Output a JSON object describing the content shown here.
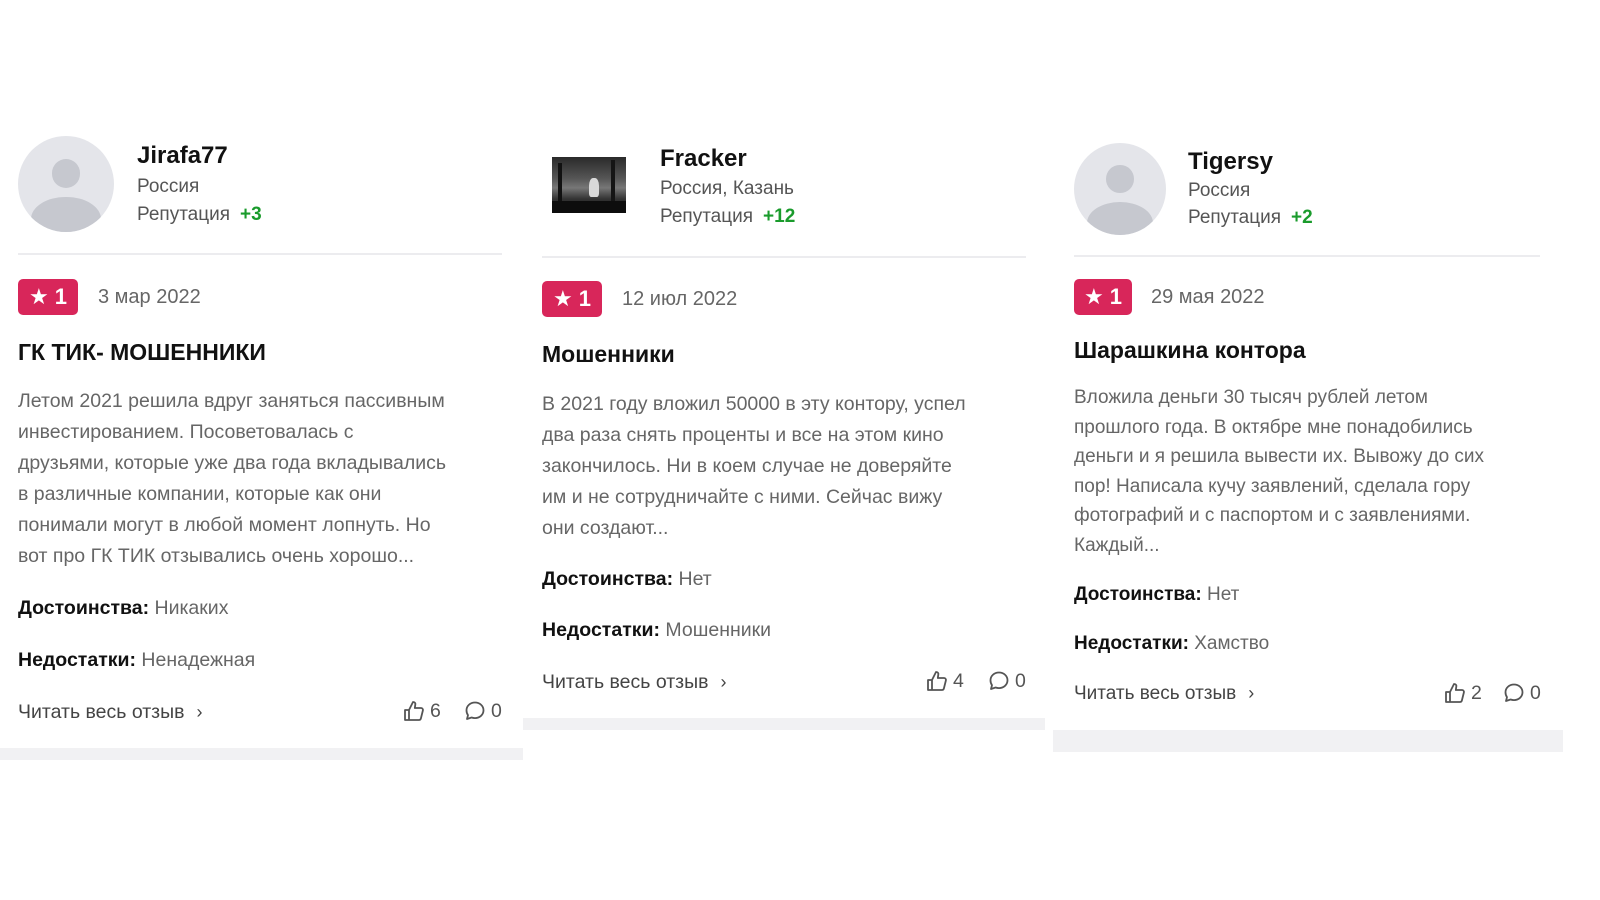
{
  "reviews": [
    {
      "user": {
        "name": "Jirafa77",
        "location": "Россия",
        "reputation_label": "Репутация",
        "reputation": "+3",
        "avatar": "default-avatar"
      },
      "rating": "1",
      "date": "3 мар 2022",
      "title": "ГК ТИК- МОШЕННИКИ",
      "text_lines": [
        "Летом 2021 решила вдруг заняться пассивным",
        "инвестированием. Посоветовалась с",
        "друзьями, которые уже два года вкладывались",
        "в различные компании, которые как они",
        "понимали могут в любой момент лопнуть. Но",
        "вот про ГК ТИК отзывались очень хорошо..."
      ],
      "pros_label": "Достоинства:",
      "pros": "Никаких",
      "cons_label": "Недостатки:",
      "cons": "Ненадежная",
      "read_more": "Читать весь отзыв",
      "likes": "6",
      "comments": "0"
    },
    {
      "user": {
        "name": "Fracker",
        "location": "Россия, Казань",
        "reputation_label": "Репутация",
        "reputation": "+12",
        "avatar": "photo-avatar"
      },
      "rating": "1",
      "date": "12 июл 2022",
      "title": "Мошенники",
      "text_lines": [
        "В 2021 году вложил 50000 в эту контору, успел",
        "два раза снять проценты и все на этом кино",
        "закончилось. Ни в коем случае не доверяйте",
        "им и не сотрудничайте с ними. Сейчас вижу",
        "они создают..."
      ],
      "pros_label": "Достоинства:",
      "pros": "Нет",
      "cons_label": "Недостатки:",
      "cons": "Мошенники",
      "read_more": "Читать весь отзыв",
      "likes": "4",
      "comments": "0"
    },
    {
      "user": {
        "name": "Tigersy",
        "location": "Россия",
        "reputation_label": "Репутация",
        "reputation": "+2",
        "avatar": "default-avatar"
      },
      "rating": "1",
      "date": "29 мая 2022",
      "title": "Шарашкина контора",
      "text_lines": [
        "Вложила деньги 30 тысяч рублей летом",
        "прошлого года. В октябре мне понадобились",
        "деньги и я решила вывести их. Вывожу до сих",
        "пор! Написала кучу заявлений, сделала гору",
        "фотографий и с паспортом и с заявлениями.",
        "Каждый..."
      ],
      "pros_label": "Достоинства:",
      "pros": "Нет",
      "cons_label": "Недостатки:",
      "cons": "Хамство",
      "read_more": "Читать весь отзыв",
      "likes": "2",
      "comments": "0"
    }
  ],
  "colors": {
    "rating_badge": "#d8265a",
    "reputation_positive": "#1a9b2c"
  }
}
